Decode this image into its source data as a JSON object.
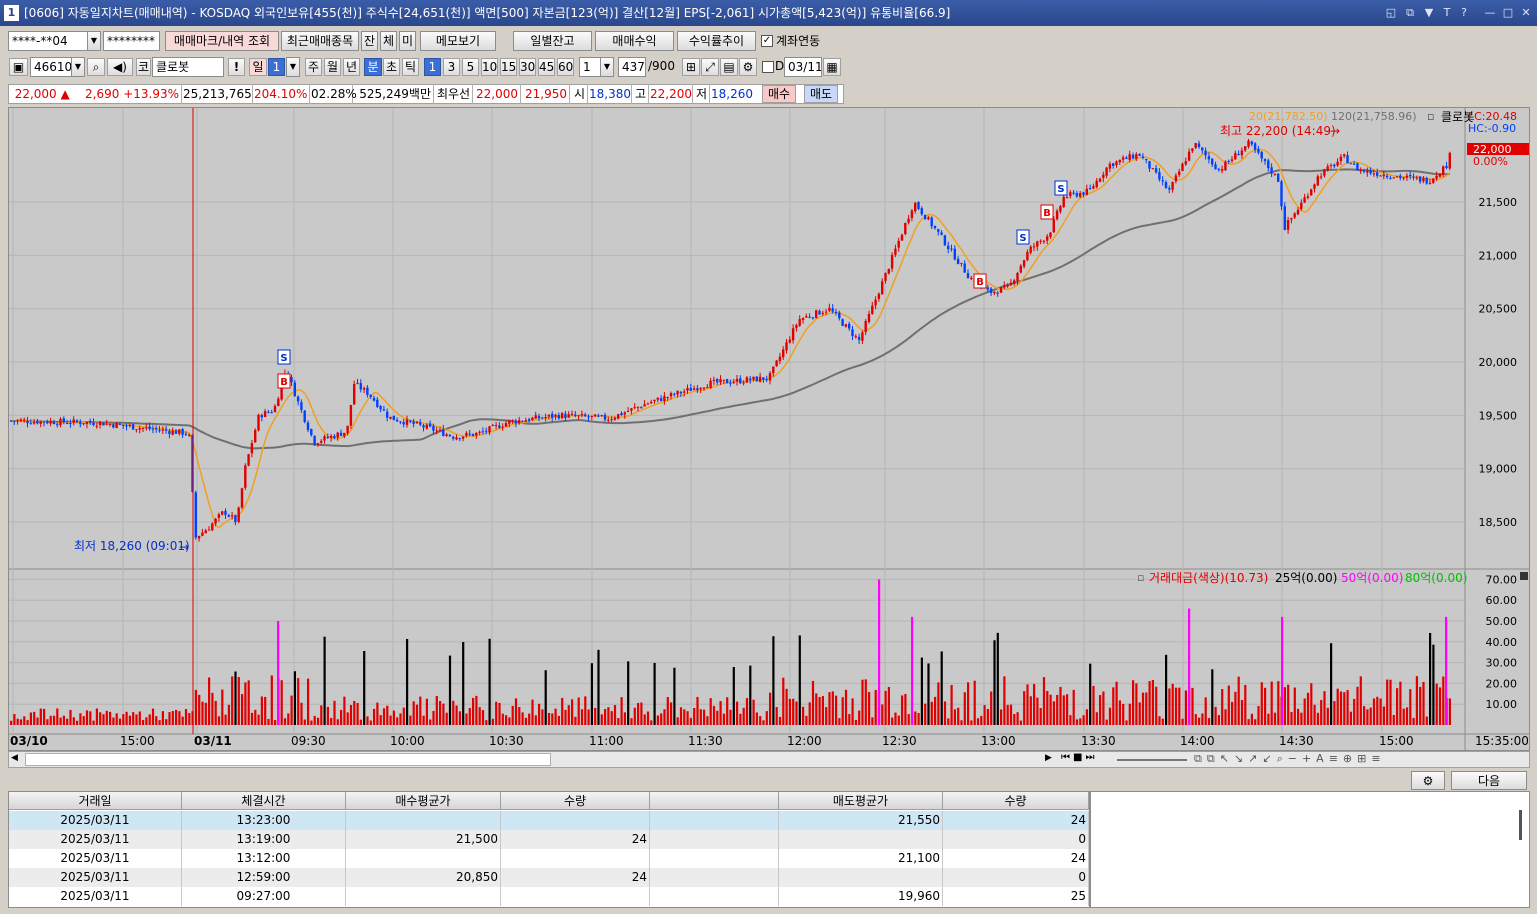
{
  "window": {
    "number": "1",
    "title": "[0606] 자동일지차트(매매내역) - KOSDAQ 외국인보유[455(천)] 주식수[24,651(천)] 액면[500] 자본금[123(억)] 결산[12월] EPS[-2,061] 시가총액[5,423(억)] 유통비율[66.9]"
  },
  "toolbar1": {
    "account": "****-**04",
    "password": "********",
    "mark_btn": "매매마크/내역 조회",
    "recent_btn": "최근매매종목",
    "jan": "잔",
    "che": "체",
    "mi": "미",
    "memo_btn": "메모보기",
    "daily_btn": "일별잔고",
    "profit_btn": "매매수익",
    "yield_btn": "수익률추이",
    "link_label": "계좌연동"
  },
  "toolbar2": {
    "code": "466100",
    "stock_prefix": "코",
    "stock_name": "클로봇",
    "day": "일",
    "day_n": "1",
    "week": "주",
    "month": "월",
    "year": "년",
    "minute": "분",
    "second": "초",
    "tick": "틱",
    "periods": [
      "1",
      "3",
      "5",
      "10",
      "15",
      "30",
      "45",
      "60"
    ],
    "count": "1",
    "bars": "437",
    "bars_total": "/900",
    "d_label": "D",
    "date": "03/11"
  },
  "quote": {
    "price": "22,000 ▲",
    "change": "2,690",
    "pct": "+13.93%",
    "volume": "25,213,765",
    "vol_ratio": "204.10%",
    "turnover": "02.28%",
    "amount": "525,249백만",
    "best_label": "최우선",
    "ask": "22,000",
    "bid": "21,950",
    "open_label": "시",
    "open": "18,380",
    "high_label": "고",
    "high": "22,200",
    "low_label": "저",
    "low": "18,260",
    "buy_btn": "매수",
    "sell_btn": "매도"
  },
  "chart": {
    "ma20": "20(21,782.50)",
    "ma120": "120(21,758.96)",
    "name": "클로봇",
    "lc": "LC:20.48",
    "hc": "HC:-0.90",
    "cur_price": "22,000",
    "cur_pct": "0.00%",
    "high_note": "최고 22,200 (14:49)",
    "low_note": "최저 18,260 (09:01)",
    "y_ticks": [
      "21,500",
      "21,000",
      "20,500",
      "20,000",
      "19,500",
      "19,000",
      "18,500"
    ],
    "vol_title": "거래대금(색상)(10.73)",
    "vol_l25": "25억(0.00)",
    "vol_l50": "50억(0.00)",
    "vol_l80": "80억(0.00)",
    "vol_ticks": [
      "70.00",
      "60.00",
      "50.00",
      "40.00",
      "30.00",
      "20.00",
      "10.00"
    ],
    "x_ticks": [
      "03/10",
      "15:00",
      "03/11",
      "09:30",
      "10:00",
      "10:30",
      "11:00",
      "11:30",
      "12:00",
      "12:30",
      "13:00",
      "13:30",
      "14:00",
      "14:30",
      "15:00"
    ],
    "x_end": "15:35:00",
    "colors": {
      "up": "#e00000",
      "down": "#0040ff",
      "ma20": "#f0a020",
      "ma120": "#707070",
      "vol50": "#ff00ff"
    }
  },
  "next_btn": "다음",
  "table": {
    "headers": [
      "거래일",
      "체결시간",
      "매수평균가",
      "수량",
      "",
      "매도평균가",
      "수량"
    ],
    "rows": [
      [
        "2025/03/11",
        "13:23:00",
        "",
        "",
        "",
        "21,550",
        "24"
      ],
      [
        "2025/03/11",
        "13:19:00",
        "21,500",
        "24",
        "",
        "",
        "0"
      ],
      [
        "2025/03/11",
        "13:12:00",
        "",
        "",
        "",
        "21,100",
        "24"
      ],
      [
        "2025/03/11",
        "12:59:00",
        "20,850",
        "24",
        "",
        "",
        "0"
      ],
      [
        "2025/03/11",
        "09:27:00",
        "",
        "",
        "",
        "19,960",
        "25"
      ]
    ]
  }
}
